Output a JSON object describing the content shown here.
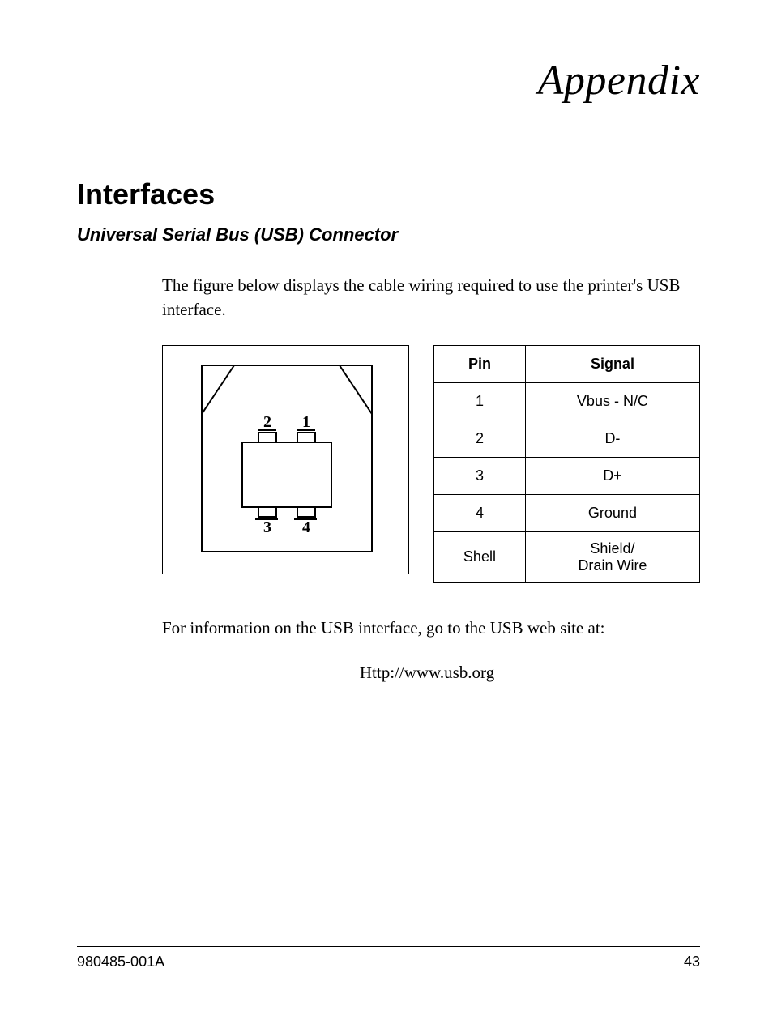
{
  "top_title": "Appendix",
  "heading": "Interfaces",
  "subheading": "Universal Serial Bus (USB) Connector",
  "intro_para": "The figure below displays the cable wiring required to use the printer's USB interface.",
  "diagram": {
    "pin_labels": {
      "p1": "1",
      "p2": "2",
      "p3": "3",
      "p4": "4"
    }
  },
  "table": {
    "headers": {
      "col1": "Pin",
      "col2": "Signal"
    },
    "rows": [
      {
        "pin": "1",
        "signal": "Vbus - N/C"
      },
      {
        "pin": "2",
        "signal": "D-"
      },
      {
        "pin": "3",
        "signal": "D+"
      },
      {
        "pin": "4",
        "signal": "Ground"
      },
      {
        "pin": "Shell",
        "signal": "Shield/\nDrain Wire"
      }
    ]
  },
  "outro_para": "For information on the USB interface,  go to the USB web site at:",
  "url_line": "Http://www.usb.org",
  "footer": {
    "doc_id": "980485-001A",
    "page_no": "43"
  }
}
